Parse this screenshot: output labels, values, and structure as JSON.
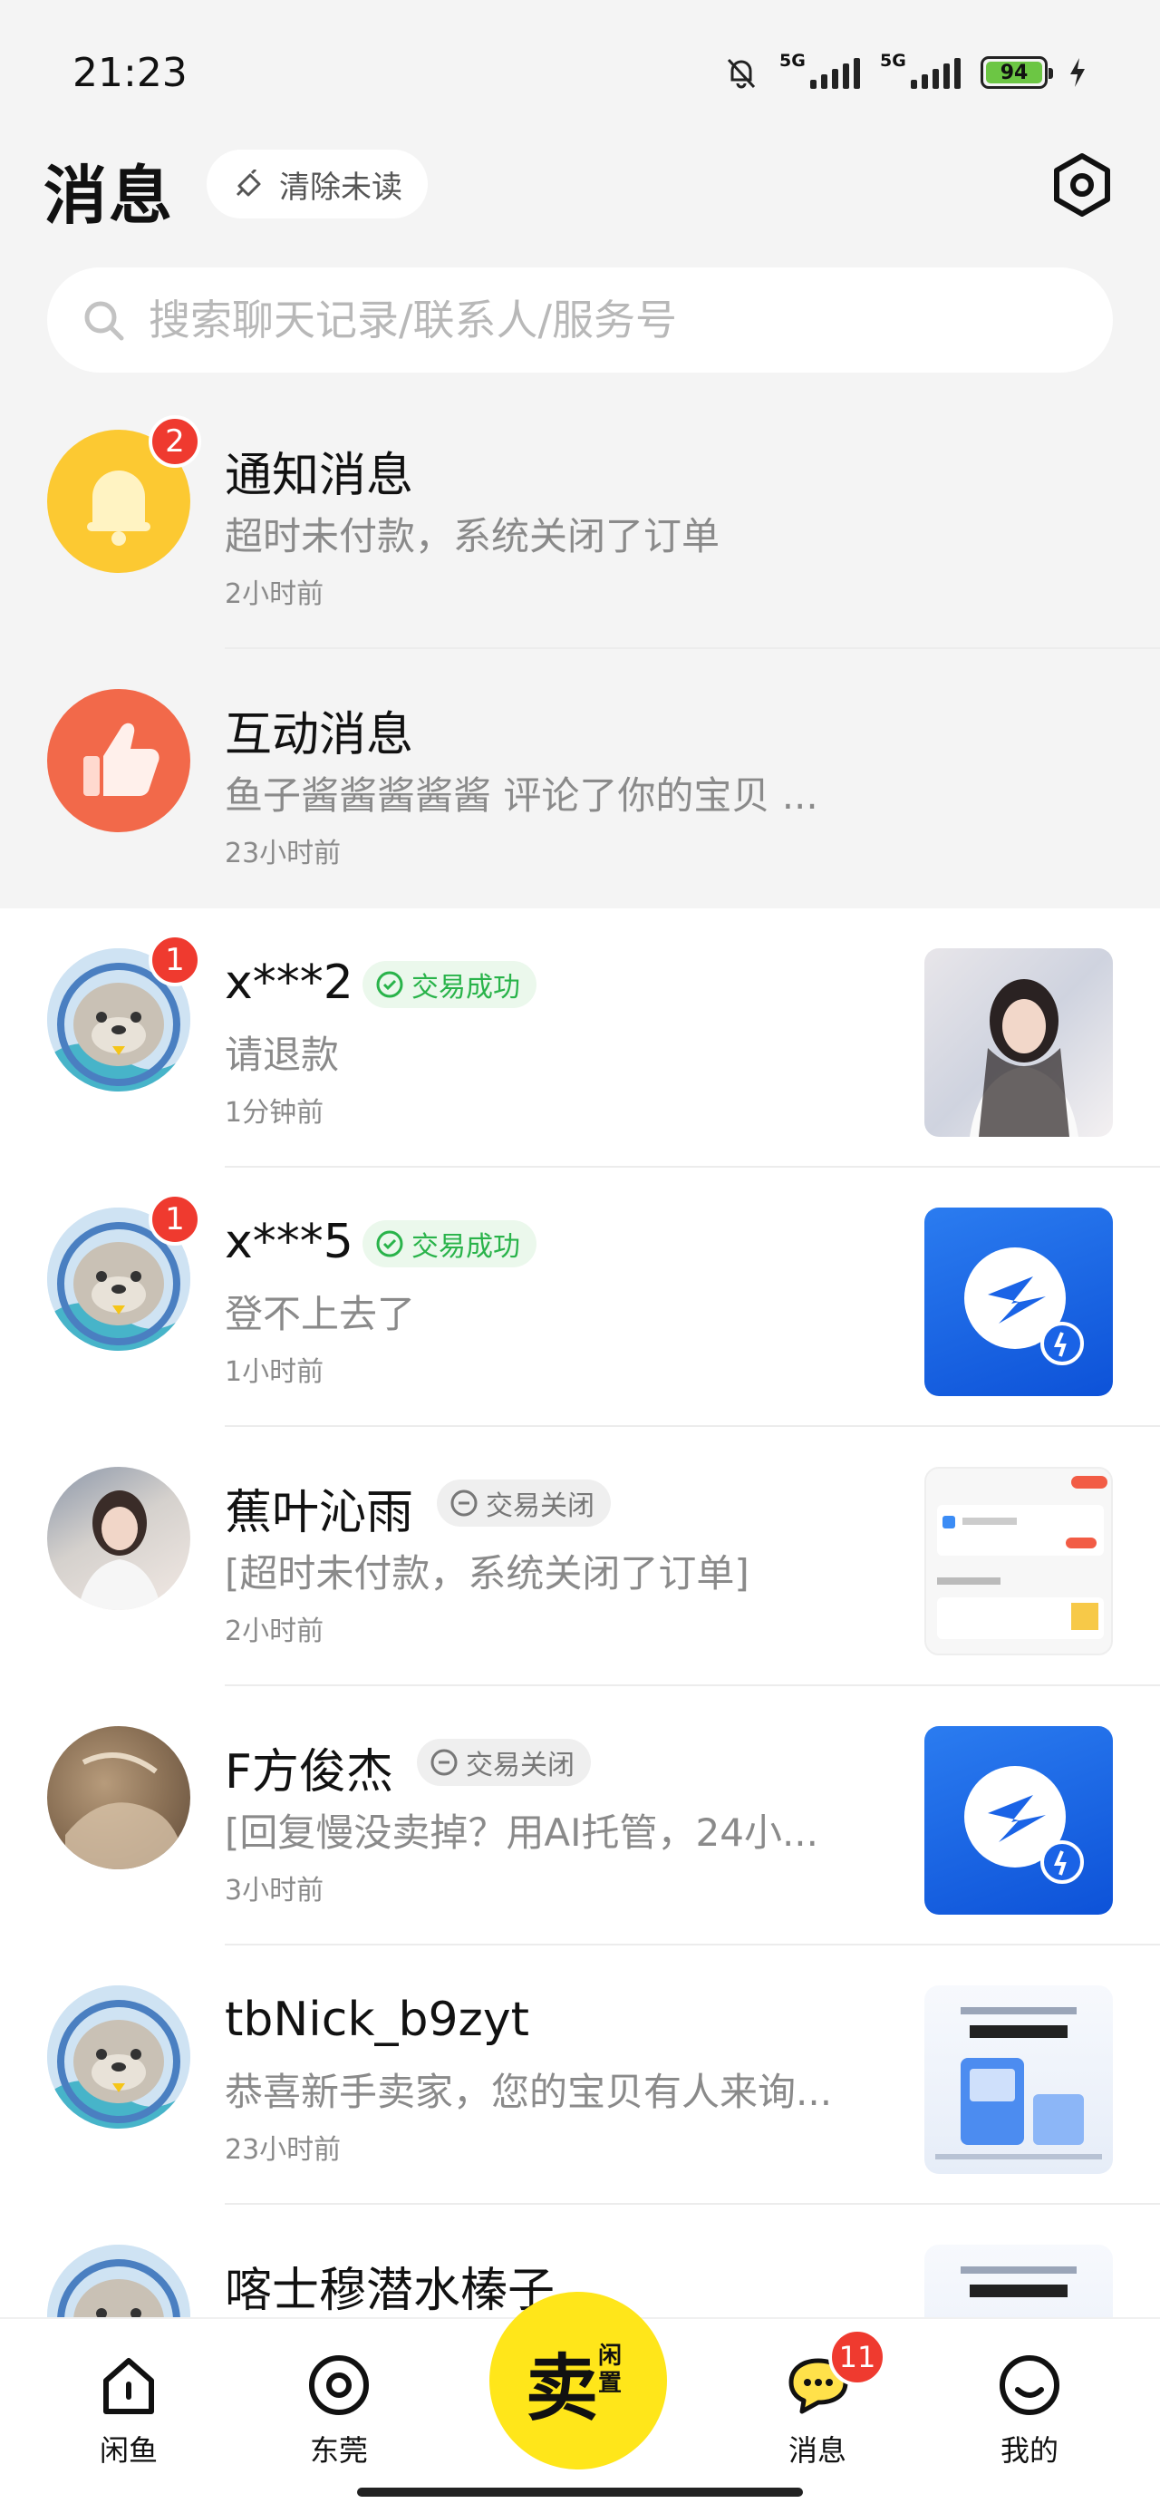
{
  "status_bar": {
    "time": "21:23",
    "net1": "5G",
    "net2": "5G",
    "battery": "94",
    "icons": [
      "mute-bell-icon",
      "signal-icon",
      "signal-icon",
      "battery-icon",
      "charging-icon"
    ]
  },
  "header": {
    "title": "消息",
    "clear_unread_label": "清除未读",
    "settings_icon": "settings-icon"
  },
  "search": {
    "placeholder": "搜索聊天记录/联系人/服务号"
  },
  "system_rows": [
    {
      "name": "通知消息",
      "preview": "超时未付款，系统关闭了订单",
      "time": "2小时前",
      "badge": "2",
      "icon": "bell-icon",
      "color": "#fcc932"
    },
    {
      "name": "互动消息",
      "preview": "鱼子酱酱酱酱酱 评论了你的宝贝 ...",
      "time": "23小时前",
      "icon": "thumbs-up-icon",
      "color": "#f2694a"
    }
  ],
  "chats": [
    {
      "name": "x***2",
      "status": "交易成功",
      "status_type": "success",
      "preview": "请退款",
      "time": "1分钟前",
      "badge": "1",
      "avatar": "otter-avatar",
      "thumb": "product-photo"
    },
    {
      "name": "x***5",
      "status": "交易成功",
      "status_type": "success",
      "preview": "登不上去了",
      "time": "1小时前",
      "badge": "1",
      "avatar": "otter-avatar",
      "thumb": "app-icon"
    },
    {
      "name": "蕉叶沁雨",
      "status": "交易关闭",
      "status_type": "closed",
      "preview": "[超时未付款，系统关闭了订单]",
      "time": "2小时前",
      "avatar": "photo-avatar",
      "thumb": "screenshot"
    },
    {
      "name": "F方俊杰",
      "status": "交易关闭",
      "status_type": "closed",
      "preview": "[回复慢没卖掉？用AI托管，24小...",
      "time": "3小时前",
      "avatar": "photo-avatar",
      "thumb": "app-icon"
    },
    {
      "name": "tbNick_b9zyt",
      "preview": "恭喜新手卖家，您的宝贝有人来询...",
      "time": "23小时前",
      "avatar": "otter-avatar",
      "thumb": "ad"
    },
    {
      "name": "喀士穆潜水榛子",
      "avatar": "otter-avatar",
      "thumb": "ad"
    }
  ],
  "bottom_nav": {
    "items": [
      {
        "label": "闲鱼",
        "icon": "home-icon"
      },
      {
        "label": "东莞",
        "icon": "location-icon"
      },
      {
        "label": "消息",
        "icon": "chat-icon",
        "badge": "11"
      },
      {
        "label": "我的",
        "icon": "smile-icon"
      }
    ],
    "sell_big": "卖",
    "sell_small": "闲置"
  },
  "colors": {
    "badge": "#ef3a2f",
    "success": "#29b34a",
    "sell_button": "#ffe61a"
  }
}
